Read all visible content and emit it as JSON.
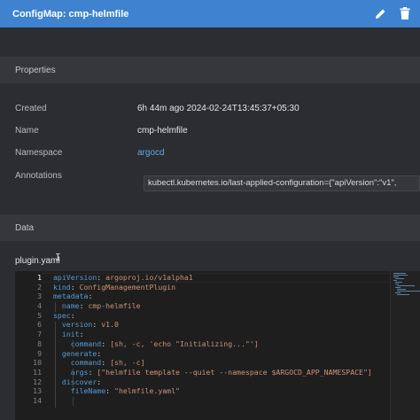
{
  "header": {
    "title": "ConfigMap: cmp-helmfile",
    "edit_icon": "pencil-icon",
    "delete_icon": "trash-icon"
  },
  "properties": {
    "heading": "Properties",
    "created_label": "Created",
    "created_value": "6h 44m ago 2024-02-24T13:45:37+05:30",
    "name_label": "Name",
    "name_value": "cmp-helmfile",
    "namespace_label": "Namespace",
    "namespace_value": "argocd",
    "annotations_label": "Annotations",
    "annotations_value": "kubectl.kubernetes.io/last-applied-configuration={\"apiVersion\":\"v1\","
  },
  "data": {
    "heading": "Data",
    "file_name": "plugin.yaml",
    "line_numbers": [
      "1",
      "2",
      "3",
      "4",
      "5",
      "6",
      "7",
      "8",
      "9",
      "10",
      "11",
      "12",
      "13",
      "14"
    ],
    "lines": [
      {
        "k": "apiVersion",
        "v": " argoproj.io/v1alpha1"
      },
      {
        "k": "kind",
        "v": " ConfigManagementPlugin"
      },
      {
        "k": "metadata",
        "v": ""
      },
      {
        "k": "  name",
        "v": " cmp-helmfile"
      },
      {
        "k": "spec",
        "v": ""
      },
      {
        "k": "  version",
        "v": " v1.0"
      },
      {
        "k": "  init",
        "v": ""
      },
      {
        "k": "    command",
        "v": " [sh, -c, 'echo \"Initializing...\"']"
      },
      {
        "k": "  generate",
        "v": ""
      },
      {
        "k": "    command",
        "v": " [sh, -c]"
      },
      {
        "k": "    args",
        "v": " [\"helmfile template --quiet --namespace $ARGOCD_APP_NAMESPACE\"]"
      },
      {
        "k": "  discover",
        "v": ""
      },
      {
        "k": "    fileName",
        "v": " \"helmfile.yaml\""
      },
      {
        "k": "",
        "v": ""
      }
    ]
  }
}
